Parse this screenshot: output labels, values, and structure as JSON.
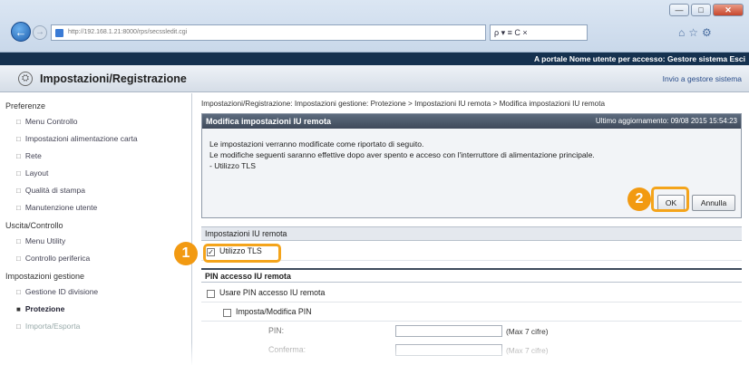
{
  "browser": {
    "url": "http://192.168.1.21:8000/rps/secssledit.cgi",
    "search_placeholder": "ρ ▾ ≡ C ×"
  },
  "portal_bar": {
    "left": "",
    "right": "A portale  Nome utente per accesso: Gestore sistema  Esci"
  },
  "header": {
    "title": "Impostazioni/Registrazione",
    "mail_link": "Invio a gestore sistema"
  },
  "sidebar": {
    "preferenze": "Preferenze",
    "items1": [
      "Menu Controllo",
      "Impostazioni alimentazione carta",
      "Rete",
      "Layout",
      "Qualità di stampa",
      "Manutenzione utente"
    ],
    "uscita": "Uscita/Controllo",
    "items2": [
      "Menu Utility",
      "Controllo periferica"
    ],
    "gestione": "Impostazioni gestione",
    "items3": [
      "Gestione ID divisione",
      "Protezione",
      "Importa/Esporta"
    ]
  },
  "breadcrumb": "Impostazioni/Registrazione: Impostazioni gestione: Protezione > Impostazioni IU remota > Modifica impostazioni IU remota",
  "dialog": {
    "title": "Modifica impostazioni IU remota",
    "updated": "Ultimo aggiornamento: 09/08 2015 15:54:23",
    "line1": "Le impostazioni verranno modificate come riportato di seguito.",
    "line2": "Le modifiche seguenti saranno effettive dopo aver spento e acceso con l'interruttore di alimentazione principale.",
    "line3": "- Utilizzo TLS",
    "ok": "OK",
    "cancel": "Annulla"
  },
  "section1": "Impostazioni IU remota",
  "use_tls": "Utilizzo TLS",
  "section2": "PIN accesso IU remota",
  "use_pin": "Usare PIN accesso IU remota",
  "set_pin": "Imposta/Modifica PIN",
  "pin_label": "PIN:",
  "confirm_label": "Conferma:",
  "pin_hint": "(Max 7 cifre)",
  "confirm_hint": "(Max 7 cifre)",
  "badge1": "1",
  "badge2": "2",
  "colors": {
    "accent": "#f29a12",
    "dark_header": "#15314f"
  }
}
